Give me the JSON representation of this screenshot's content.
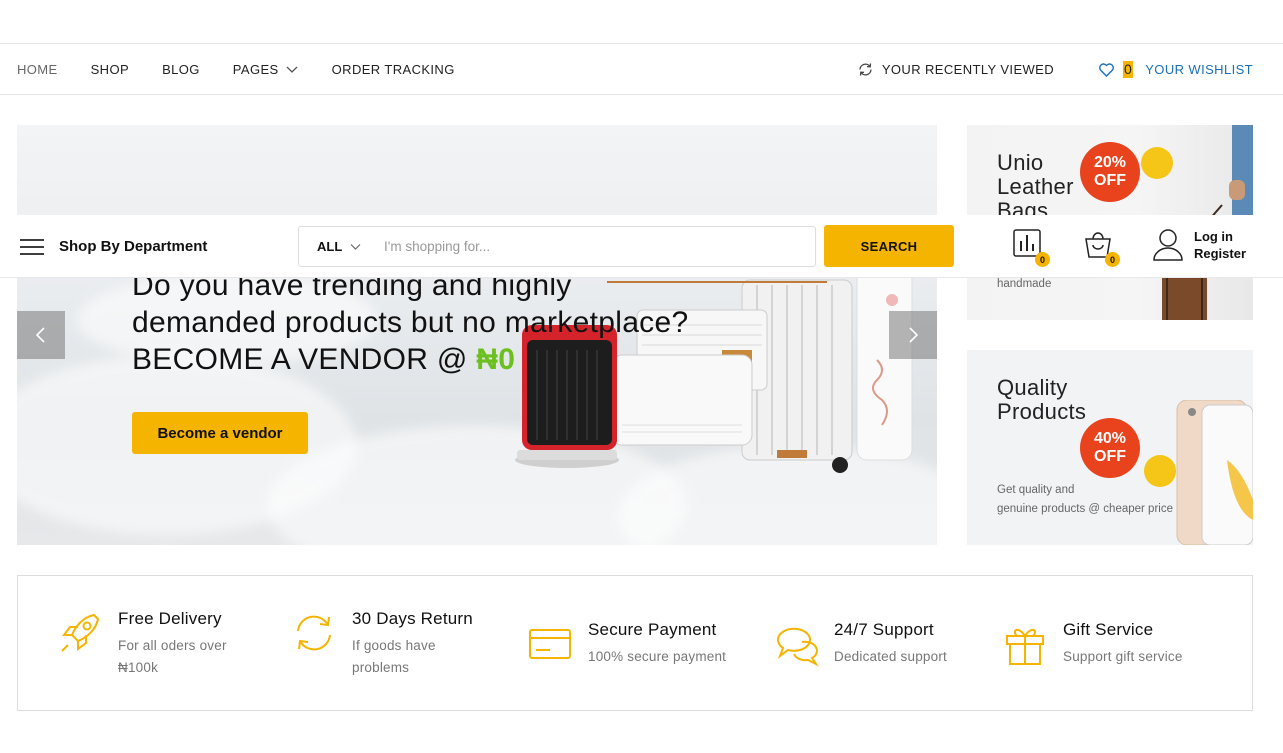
{
  "nav": {
    "items": [
      {
        "label": "HOME"
      },
      {
        "label": "SHOP"
      },
      {
        "label": "BLOG"
      },
      {
        "label": "PAGES"
      },
      {
        "label": "ORDER TRACKING"
      }
    ],
    "recently_viewed": "YOUR RECENTLY VIEWED",
    "wishlist_count": "0",
    "wishlist": "YOUR WISHLIST"
  },
  "hero": {
    "line1": "Do you have trending and highly",
    "line2": "demanded products but no marketplace?",
    "line3_prefix": "BECOME A VENDOR @",
    "line3_value": "₦0",
    "cta": "Become a vendor"
  },
  "header": {
    "department": "Shop By Department",
    "category": "ALL",
    "search_placeholder": "I'm shopping for...",
    "search_button": "SEARCH",
    "compare_count": "0",
    "cart_count": "0",
    "login": "Log in",
    "register": "Register"
  },
  "promos": [
    {
      "title1": "Unio",
      "title2": "Leather",
      "title3": "Bags",
      "badge1": "20%",
      "badge2": "OFF",
      "sub": "handmade"
    },
    {
      "title1": "Quality",
      "title2": "Products",
      "badge1": "40%",
      "badge2": "OFF",
      "sub1": "Get quality and",
      "sub2": "genuine products @ cheaper price"
    }
  ],
  "features": [
    {
      "title": "Free Delivery",
      "sub1": "For all oders over",
      "sub2": "₦100k",
      "icon": "rocket-icon"
    },
    {
      "title": "30 Days Return",
      "sub1": "If goods have",
      "sub2": "problems",
      "icon": "return-icon"
    },
    {
      "title": "Secure Payment",
      "sub1": "100% secure payment",
      "icon": "credit-card-icon"
    },
    {
      "title": "24/7 Support",
      "sub1": "Dedicated support",
      "icon": "chat-icon"
    },
    {
      "title": "Gift Service",
      "sub1": "Support gift service",
      "icon": "gift-icon"
    }
  ],
  "colors": {
    "accent": "#f5b400",
    "badge": "#e8431d",
    "link": "#1a6fb5",
    "vendor_green": "#6bbf1e"
  }
}
